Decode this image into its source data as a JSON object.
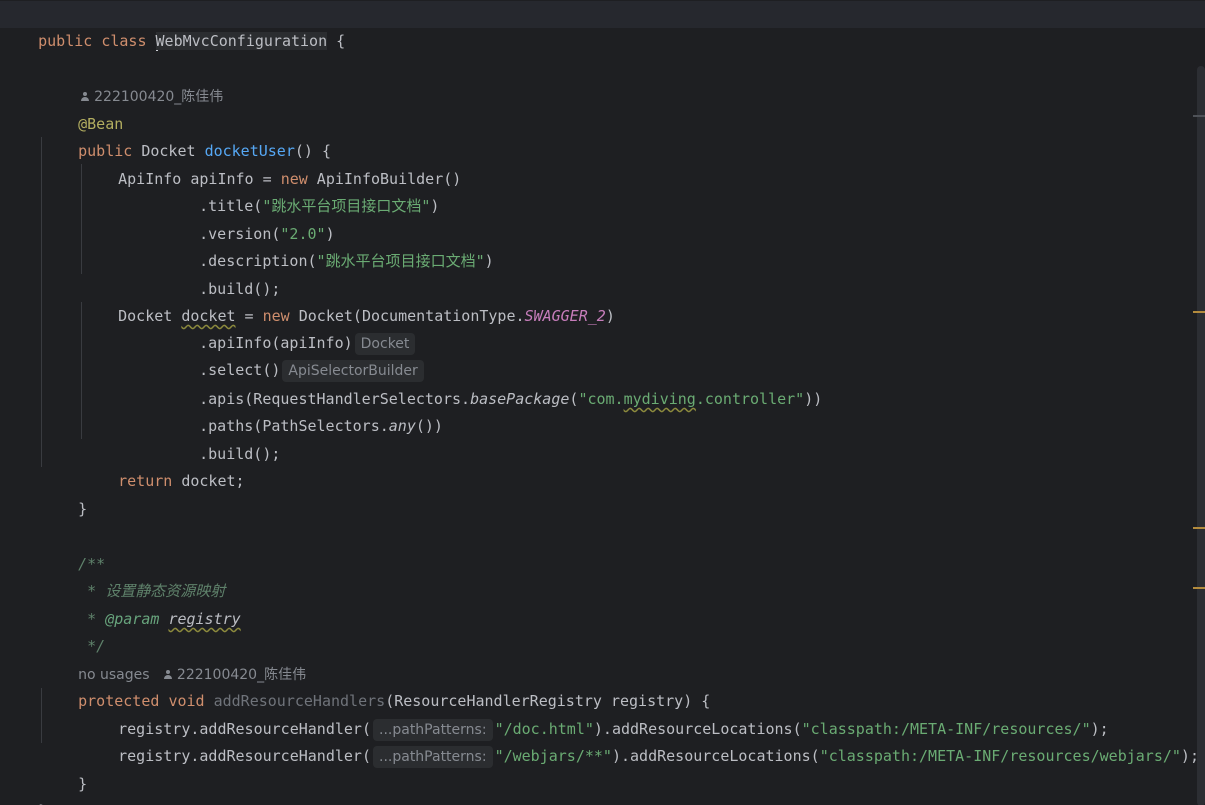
{
  "editor": {
    "class_decl": {
      "kw1": "public",
      "kw2": "class",
      "name": "WebMvcConfiguration",
      "brace": " {"
    },
    "author1": "222100420_陈佳伟",
    "bean_annotation": "@Bean",
    "method1": {
      "kw": "public",
      "type": "Docket",
      "name": "docketUser",
      "rest": "() {"
    },
    "apiinfo_line": {
      "a": "ApiInfo apiInfo = ",
      "kw": "new",
      "b": " ApiInfoBuilder()"
    },
    "title_line": {
      "a": ".title(",
      "str": "\"跳水平台项目接口文档\"",
      "b": ")"
    },
    "version_line": {
      "a": ".version(",
      "str": "\"2.0\"",
      "b": ")"
    },
    "desc_line": {
      "a": ".description(",
      "str": "\"跳水平台项目接口文档\"",
      "b": ")"
    },
    "build1": ".build();",
    "docket_line": {
      "a": "Docket ",
      "var": "docket",
      "b": " = ",
      "kw": "new",
      "c": " Docket(DocumentationType.",
      "static": "SWAGGER_2",
      "d": ")"
    },
    "apiinfo_call": {
      "code": ".apiInfo(apiInfo)",
      "hint": "Docket"
    },
    "select_call": {
      "code": ".select()",
      "hint": "ApiSelectorBuilder"
    },
    "apis_line": {
      "a": ".apis(RequestHandlerSelectors.",
      "italic": "basePackage",
      "b": "(",
      "str1": "\"com.",
      "str2": "mydiving",
      "str3": ".controller\"",
      "c": "))"
    },
    "paths_line": {
      "a": ".paths(PathSelectors.",
      "italic": "any",
      "b": "())"
    },
    "build2": ".build();",
    "return_line": {
      "kw": "return",
      "b": " docket;"
    },
    "close1": "}",
    "javadoc": {
      "open": "/**",
      "l1_star": " * ",
      "l1_text": "设置静态资源映射",
      "l2_star": " * ",
      "l2_tag": "@param",
      "l2_sp": " ",
      "l2_param": "registry",
      "close": " */"
    },
    "usages": "no usages",
    "author2": "222100420_陈佳伟",
    "method2": {
      "kw1": "protected",
      "kw2": "void",
      "name": "addResourceHandlers",
      "rest": "(ResourceHandlerRegistry registry) {"
    },
    "handler1": {
      "a": "registry.addResourceHandler(",
      "hint": "...pathPatterns:",
      "str1": "\"/doc.html\"",
      "b": ").addResourceLocations(",
      "str2": "\"classpath:/META-INF/resources/\"",
      "c": ");"
    },
    "handler2": {
      "a": "registry.addResourceHandler(",
      "hint": "...pathPatterns:",
      "str1": "\"/webjars/**\"",
      "b": ").addResourceLocations(",
      "str2": "\"classpath:/META-INF/resources/webjars/\"",
      "c": ");"
    },
    "close2": "}",
    "close3": "}"
  },
  "colors": {
    "background": "#1e1f22",
    "keyword": "#cf8e6d",
    "function": "#56a8f5",
    "string": "#6aab73",
    "annotation": "#b3ae60",
    "comment": "#5f826b",
    "static_field": "#c77dbb",
    "text": "#bcbec4",
    "hint": "#868a91"
  }
}
